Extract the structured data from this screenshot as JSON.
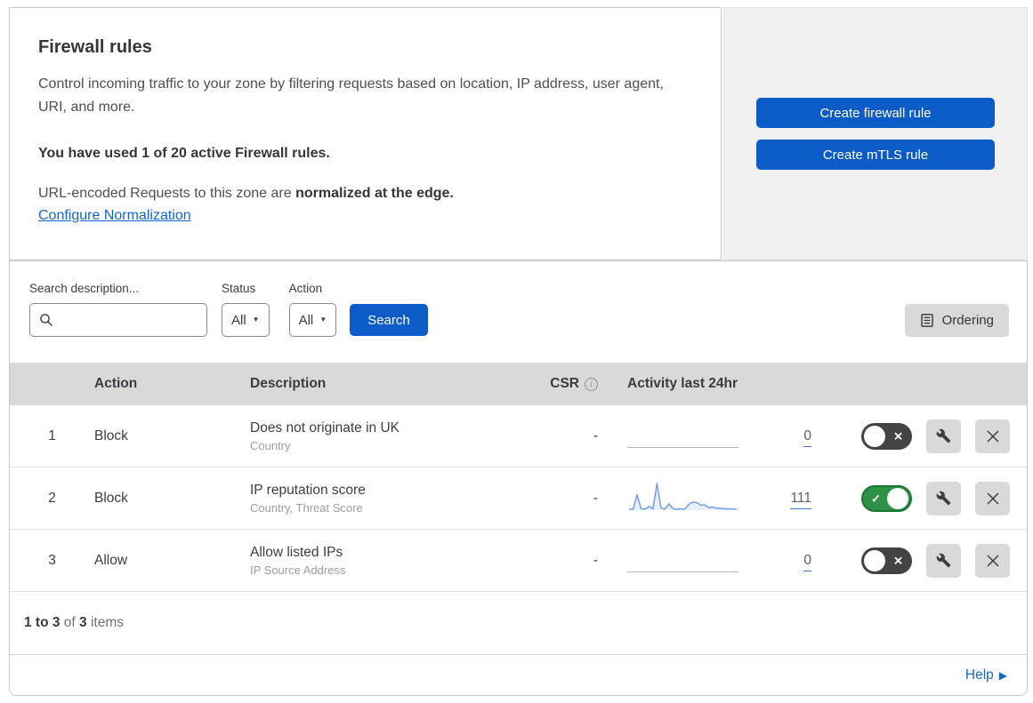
{
  "intro": {
    "title": "Firewall rules",
    "description": "Control incoming traffic to your zone by filtering requests based on location, IP address, user agent, URI, and more.",
    "usage_bold": "You have used 1 of 20 active Firewall rules.",
    "normalization_prefix": "URL-encoded Requests to this zone are ",
    "normalization_bold": "normalized at the edge.",
    "normalization_link": "Configure Normalization"
  },
  "actions_panel": {
    "create_firewall_label": "Create firewall rule",
    "create_mtls_label": "Create mTLS rule"
  },
  "filters": {
    "search_label": "Search description...",
    "search_value": "",
    "status_label": "Status",
    "status_value": "All",
    "action_label": "Action",
    "action_value": "All",
    "search_button": "Search",
    "ordering_button": "Ordering"
  },
  "table": {
    "columns": {
      "action": "Action",
      "description": "Description",
      "csr": "CSR",
      "csr_info_icon": "i",
      "activity": "Activity last 24hr"
    },
    "rows": [
      {
        "priority": "1",
        "action": "Block",
        "description": "Does not originate in UK",
        "criteria": "Country",
        "csr": "-",
        "activity_count": "0",
        "enabled": false,
        "sparkline": null
      },
      {
        "priority": "2",
        "action": "Block",
        "description": "IP reputation score",
        "criteria": "Country, Threat Score",
        "csr": "-",
        "activity_count": "111",
        "enabled": true,
        "sparkline": [
          4,
          3,
          58,
          6,
          3,
          14,
          5,
          100,
          8,
          4,
          24,
          6,
          3,
          5,
          4,
          22,
          30,
          28,
          18,
          20,
          9,
          12,
          7,
          7,
          5,
          5,
          4,
          4
        ]
      },
      {
        "priority": "3",
        "action": "Allow",
        "description": "Allow listed IPs",
        "criteria": "IP Source Address",
        "csr": "-",
        "activity_count": "0",
        "enabled": false,
        "sparkline": null
      }
    ]
  },
  "footer": {
    "range_bold": "1 to 3",
    "of_text": " of ",
    "total_bold": "3",
    "items_text": " items",
    "help_label": "Help"
  },
  "colors": {
    "primary_blue": "#0b5bc8",
    "link_blue": "#1566d0",
    "toggle_on_green": "#2e9148",
    "toggle_off_gray": "#414345",
    "header_gray": "#d9d9d9",
    "panel_gray": "#f0f0f1",
    "sparkline_blue": "#699bea"
  }
}
